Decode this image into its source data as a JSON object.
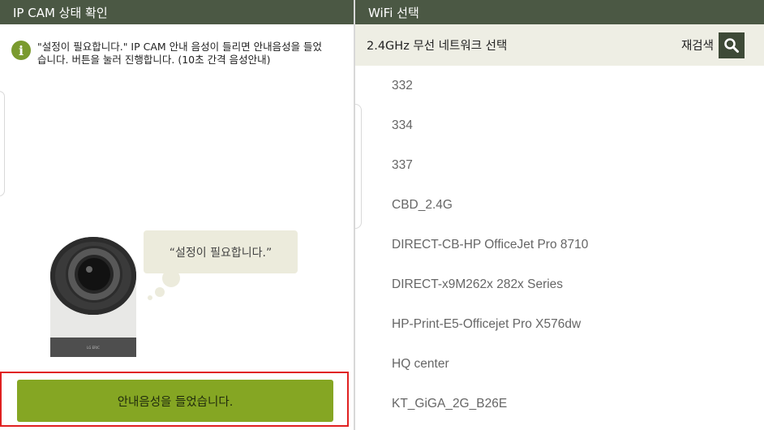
{
  "left_panel": {
    "title": "IP CAM 상태 확인",
    "notice_icon": "info-icon",
    "notice_icon_glyph": "i",
    "notice_text": "\"설정이 필요합니다.\" IP CAM 안내 음성이 들리면 안내음성을 들었습니다. 버튼을 눌러 진행합니다. (10초 간격 음성안내)",
    "speech_bubble": "“설정이 필요합니다.”",
    "camera_brand": "LG ERIC",
    "action_button": "안내음성을 들었습니다.",
    "colors": {
      "titlebar": "#4b5844",
      "button": "#85a623",
      "highlight_border": "#e02020"
    }
  },
  "right_panel": {
    "title": "WiFi 선택",
    "subheader_title": "2.4GHz 무선 네트워크 선택",
    "rescan_label": "재검색",
    "search_icon": "search-icon",
    "networks": [
      "332",
      "334",
      "337",
      "CBD_2.4G",
      "DIRECT-CB-HP OfficeJet Pro 8710",
      "DIRECT-x9M262x 282x Series",
      "HP-Print-E5-Officejet Pro X576dw",
      "HQ center",
      "KT_GiGA_2G_B26E"
    ]
  }
}
